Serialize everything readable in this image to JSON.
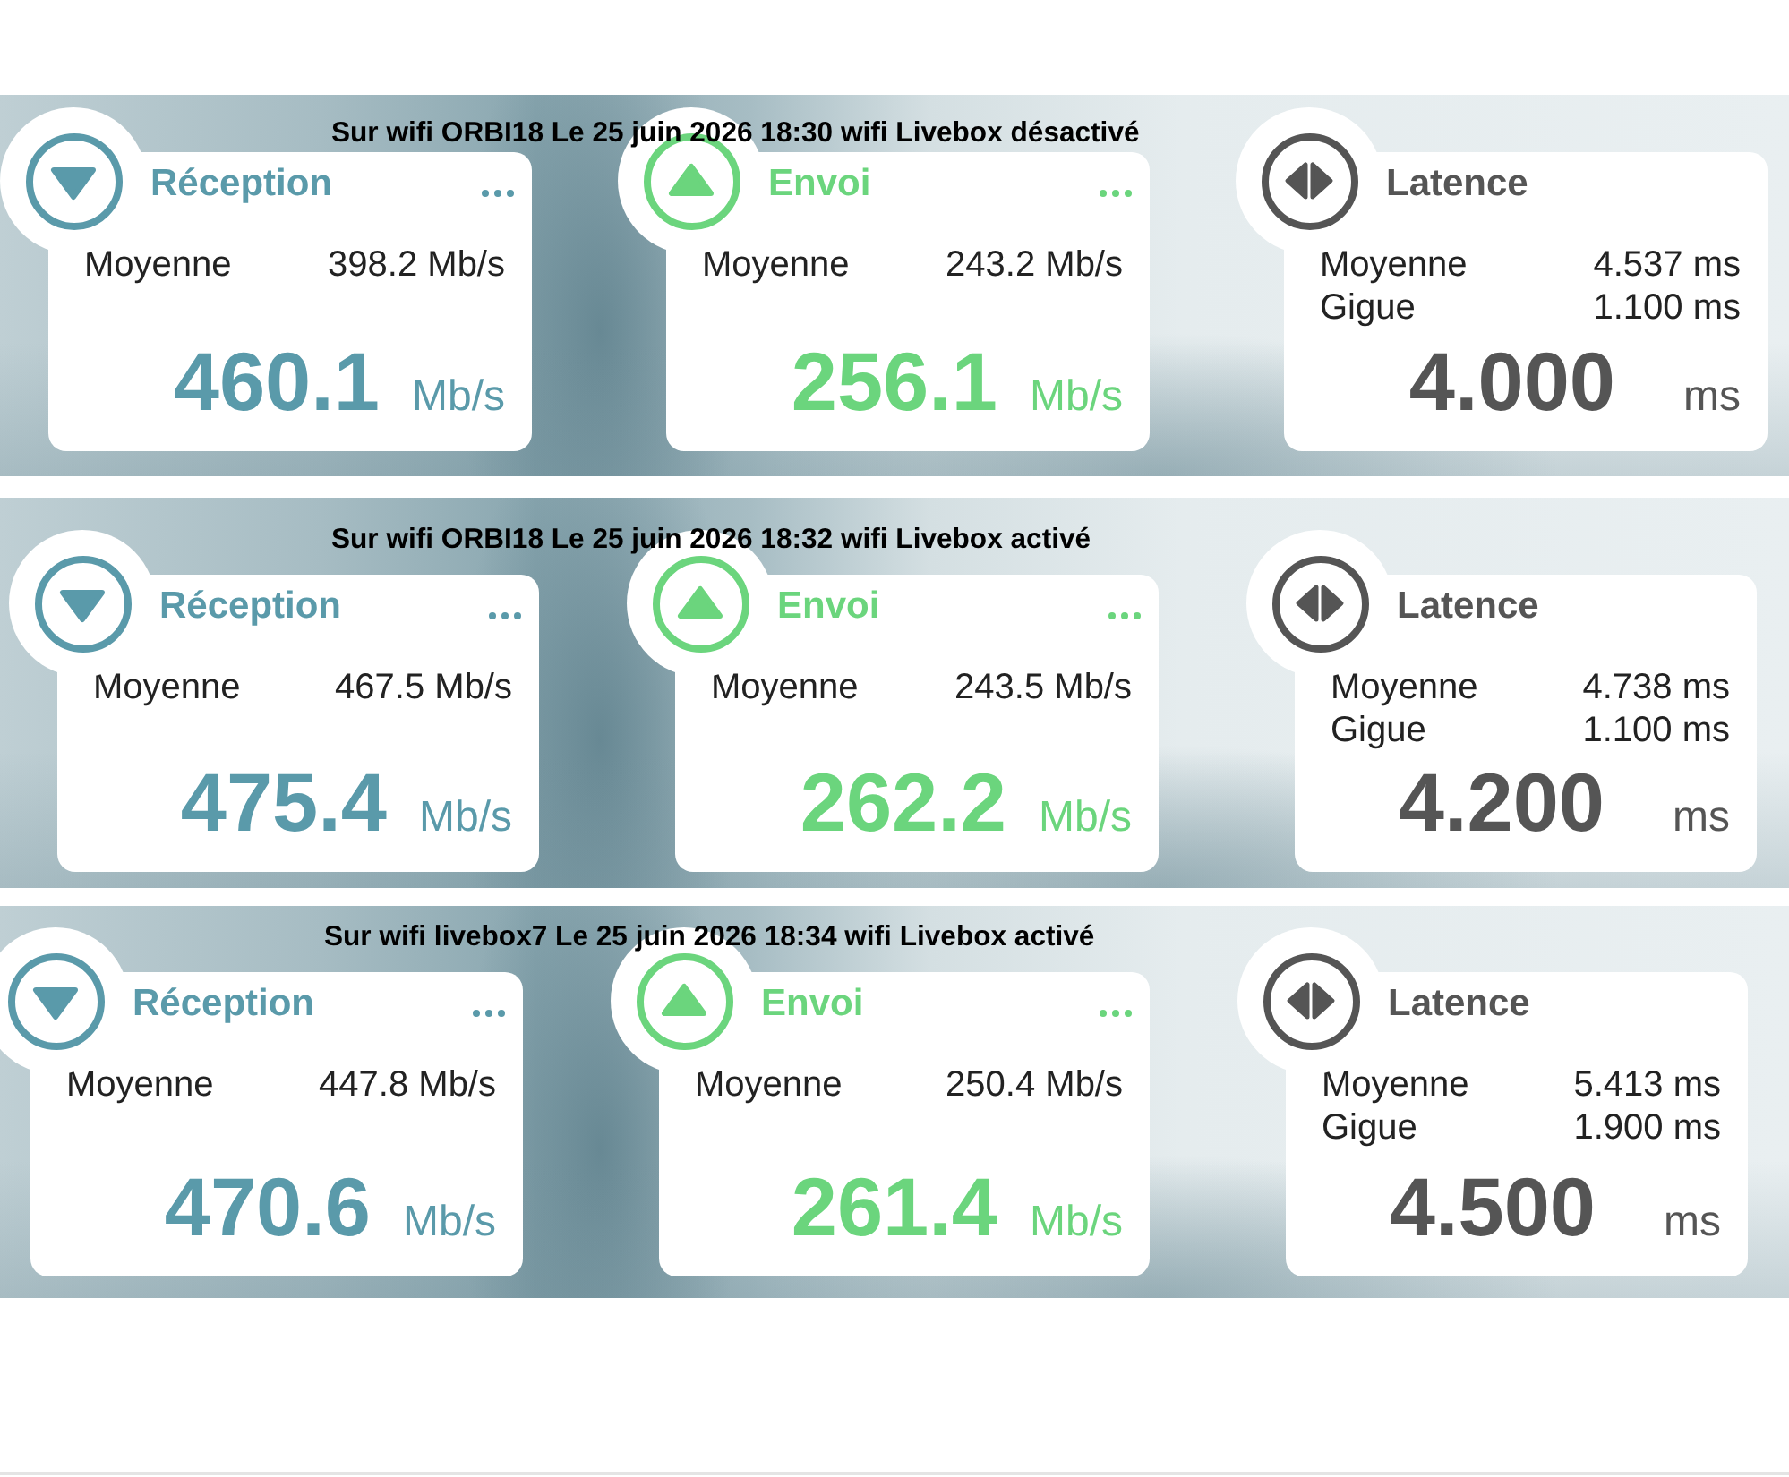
{
  "panels": [
    {
      "caption": "Sur wifi ORBI18 Le 25 juin 2026 18:30 wifi Livebox désactivé",
      "cards": [
        {
          "kind": "download",
          "color": "#5a9aaa",
          "title": "Réception",
          "more_menu": true,
          "rows": [
            {
              "label": "Moyenne",
              "value": "398.2 Mb/s"
            }
          ],
          "value": "460.1",
          "unit": "Mb/s"
        },
        {
          "kind": "upload",
          "color": "#6bd57d",
          "title": "Envoi",
          "more_menu": true,
          "rows": [
            {
              "label": "Moyenne",
              "value": "243.2 Mb/s"
            }
          ],
          "value": "256.1",
          "unit": "Mb/s"
        },
        {
          "kind": "latency",
          "color": "#555555",
          "title": "Latence",
          "more_menu": false,
          "rows": [
            {
              "label": "Moyenne",
              "value": "4.537 ms"
            },
            {
              "label": "Gigue",
              "value": "1.100 ms"
            }
          ],
          "value": "4.000",
          "unit": "ms"
        }
      ]
    },
    {
      "caption": "Sur wifi ORBI18 Le 25 juin 2026 18:32 wifi Livebox activé",
      "cards": [
        {
          "kind": "download",
          "color": "#5a9aaa",
          "title": "Réception",
          "more_menu": true,
          "rows": [
            {
              "label": "Moyenne",
              "value": "467.5 Mb/s"
            }
          ],
          "value": "475.4",
          "unit": "Mb/s"
        },
        {
          "kind": "upload",
          "color": "#6bd57d",
          "title": "Envoi",
          "more_menu": true,
          "rows": [
            {
              "label": "Moyenne",
              "value": "243.5 Mb/s"
            }
          ],
          "value": "262.2",
          "unit": "Mb/s"
        },
        {
          "kind": "latency",
          "color": "#555555",
          "title": "Latence",
          "more_menu": false,
          "rows": [
            {
              "label": "Moyenne",
              "value": "4.738 ms"
            },
            {
              "label": "Gigue",
              "value": "1.100 ms"
            }
          ],
          "value": "4.200",
          "unit": "ms"
        }
      ]
    },
    {
      "caption": "Sur wifi livebox7 Le 25 juin 2026 18:34 wifi Livebox activé",
      "cards": [
        {
          "kind": "download",
          "color": "#5a9aaa",
          "title": "Réception",
          "more_menu": true,
          "rows": [
            {
              "label": "Moyenne",
              "value": "447.8 Mb/s"
            }
          ],
          "value": "470.6",
          "unit": "Mb/s"
        },
        {
          "kind": "upload",
          "color": "#6bd57d",
          "title": "Envoi",
          "more_menu": true,
          "rows": [
            {
              "label": "Moyenne",
              "value": "250.4 Mb/s"
            }
          ],
          "value": "261.4",
          "unit": "Mb/s"
        },
        {
          "kind": "latency",
          "color": "#555555",
          "title": "Latence",
          "more_menu": false,
          "rows": [
            {
              "label": "Moyenne",
              "value": "5.413 ms"
            },
            {
              "label": "Gigue",
              "value": "1.900 ms"
            }
          ],
          "value": "4.500",
          "unit": "ms"
        }
      ]
    }
  ]
}
